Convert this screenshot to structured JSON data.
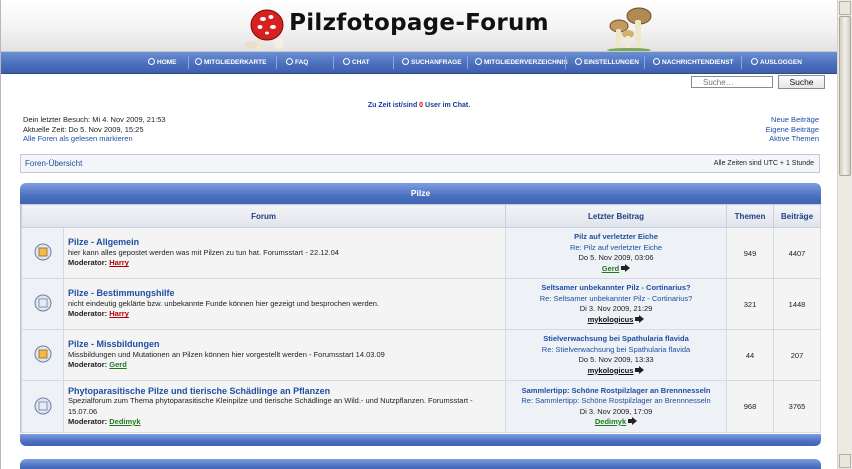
{
  "site": {
    "title": "Pilzfotopage-Forum"
  },
  "nav": [
    {
      "label": "HOME",
      "icon": "home-icon"
    },
    {
      "label": "MITGLIEDERKARTE",
      "icon": "map-icon"
    },
    {
      "label": "FAQ",
      "icon": "help-icon"
    },
    {
      "label": "CHAT",
      "icon": "chat-icon"
    },
    {
      "label": "SUCHANFRAGE",
      "icon": "search-icon"
    },
    {
      "label": "MITGLIEDERVERZEICHNIS",
      "icon": "members-icon"
    },
    {
      "label": "EINSTELLUNGEN",
      "icon": "settings-icon"
    },
    {
      "label": "NACHRICHTENDIENST",
      "icon": "messages-icon"
    },
    {
      "label": "AUSLOGGEN",
      "icon": "logout-icon"
    }
  ],
  "search": {
    "placeholder": "Suche…",
    "button": "Suche"
  },
  "chat_status": {
    "prefix": "Zu Zeit ist/sind",
    "count": "0",
    "suffix": "User im Chat."
  },
  "session": {
    "last_visit": "Dein letzter Besuch: Mi 4. Nov 2009, 21:53",
    "current_time": "Aktuelle Zeit: Do 5. Nov 2009, 15:25",
    "mark_read": "Alle Foren als gelesen markieren"
  },
  "quicklinks": [
    "Neue Beiträge",
    "Eigene Beiträge",
    "Aktive Themen"
  ],
  "breadcrumb": {
    "label": "Foren-Übersicht",
    "timezone": "Alle Zeiten sind UTC + 1 Stunde"
  },
  "category": {
    "title": "Pilze"
  },
  "table": {
    "headers": {
      "forum": "Forum",
      "last_post": "Letzter Beitrag",
      "topics": "Themen",
      "posts": "Beiträge"
    },
    "moderator_label": "Moderator:",
    "rows": [
      {
        "title": "Pilze - Allgemein",
        "description": "hier kann alles gepostet werden was mit Pilzen zu tun hat. Forumsstart - 22.12.04",
        "moderator": "Harry",
        "moderator_color": "#b10000",
        "last_topic": "Pilz auf verletzter Eiche",
        "last_re": "Re: Pilz auf verletzter Eiche",
        "last_date": "Do 5. Nov 2009, 03:06",
        "last_user": "Gerd",
        "topics": "949",
        "posts": "4407"
      },
      {
        "title": "Pilze - Bestimmungshilfe",
        "description": "nicht eindeutig geklärte bzw. unbekannte Funde können hier gezeigt und besprochen werden.",
        "moderator": "Harry",
        "moderator_color": "#b10000",
        "last_topic": "Seltsamer unbekannter Pilz - Cortinarius?",
        "last_re": "Re: Seltsamer unbekannter Pilz - Cortinarius?",
        "last_date": "Di 3. Nov 2009, 21:29",
        "last_user": "mykologicus",
        "topics": "321",
        "posts": "1448"
      },
      {
        "title": "Pilze - Missbildungen",
        "description": "Missbildungen und Mutationen an Pilzen können hier vorgestellt werden - Forumsstart 14.03.09",
        "moderator": "Gerd",
        "moderator_color": "#1f7a1f",
        "last_topic": "Stielverwachsung bei Spathularia flavida",
        "last_re": "Re: Stielverwachsung bei Spathularia flavida",
        "last_date": "Do 5. Nov 2009, 13:33",
        "last_user": "mykologicus",
        "topics": "44",
        "posts": "207"
      },
      {
        "title": "Phytoparasitische Pilze und tierische Schädlinge an Pflanzen",
        "description": "Spezialforum zum Thema phytoparasitische Kleinpilze und tierische Schädlinge an Wild.- und Nutzpflanzen. Forumsstart - 15.07.06",
        "moderator": "Dedimyk",
        "moderator_color": "#1f7a1f",
        "last_topic": "Sammlertipp: Schöne Rostpilzlager an Brennnesseln",
        "last_re": "Re: Sammlertipp: Schöne Rostpilzlager an Brennnesseln",
        "last_date": "Di 3. Nov 2009, 17:09",
        "last_user": "Dedimyk",
        "topics": "968",
        "posts": "3765"
      }
    ]
  }
}
